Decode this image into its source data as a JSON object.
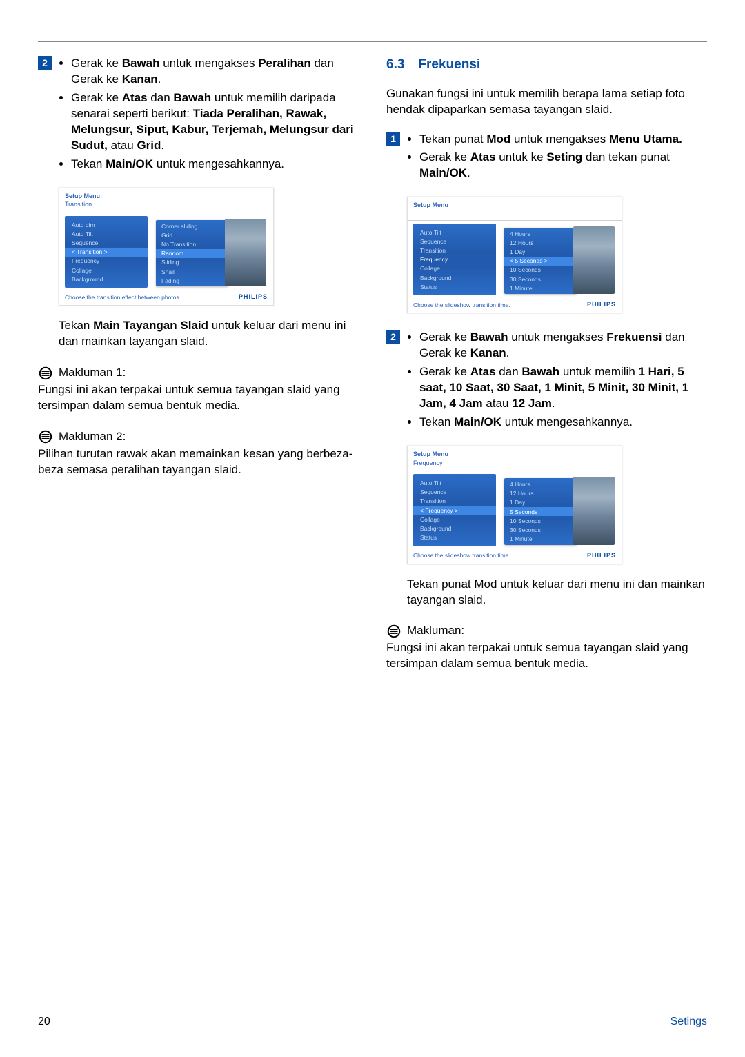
{
  "footer": {
    "page": "20",
    "section": "Setings"
  },
  "left": {
    "step2": {
      "num": "2",
      "b1_prefix": "Gerak ke ",
      "b1_bold1": "Bawah",
      "b1_mid": " untuk mengakses ",
      "b1_bold2": "Peralihan",
      "b1_mid2": " dan Gerak ke ",
      "b1_bold3": "Kanan",
      "b1_suffix": ".",
      "b2_prefix": "Gerak ke ",
      "b2_bold1": "Atas",
      "b2_mid": " dan ",
      "b2_bold2": "Bawah",
      "b2_mid2": " untuk memilih daripada senarai seperti berikut: ",
      "b2_boldlist": "Tiada Peralihan, Rawak, Melungsur, Siput, Kabur, Terjemah, Melungsur dari Sudut,",
      "b2_mid3": " atau ",
      "b2_bold3": "Grid",
      "b2_suffix": ".",
      "b3_prefix": "Tekan ",
      "b3_bold": "Main/OK",
      "b3_suffix": " untuk mengesahkannya."
    },
    "shot1": {
      "title1": "Setup Menu",
      "title2": "Transition",
      "left_items": [
        "Auto dim",
        "Auto Tilt",
        "Sequence",
        "< Transition >",
        "Frequency",
        "Collage",
        "Background"
      ],
      "left_sel_idx": 3,
      "right_items": [
        "Corner sliding",
        "Grid",
        "No Transition",
        "Random",
        "Sliding",
        "Snail",
        "Fading"
      ],
      "right_sel_idx": 3,
      "hint": "Choose the transition effect between photos.",
      "brand": "PHILIPS"
    },
    "after_shot_prefix": "Tekan ",
    "after_shot_bold": "Main Tayangan Slaid",
    "after_shot_suffix": " untuk keluar dari menu ini dan mainkan tayangan slaid.",
    "note1_title": "Makluman 1:",
    "note1_body": "Fungsi ini akan terpakai untuk semua tayangan slaid yang tersimpan dalam semua bentuk media.",
    "note2_title": "Makluman 2:",
    "note2_body": "Pilihan turutan rawak akan memainkan kesan yang berbeza-beza semasa peralihan tayangan slaid."
  },
  "right": {
    "sec_num": "6.3",
    "sec_title": "Frekuensi",
    "intro": "Gunakan fungsi ini untuk memilih berapa lama setiap foto hendak dipaparkan semasa tayangan slaid.",
    "step1": {
      "num": "1",
      "b1_prefix": "Tekan punat ",
      "b1_bold1": "Mod",
      "b1_mid": " untuk mengakses ",
      "b1_bold2": "Menu Utama.",
      "b2_prefix": "Gerak ke ",
      "b2_bold1": "Atas",
      "b2_mid": " untuk ke ",
      "b2_bold2": "Seting",
      "b2_mid2": " dan tekan punat ",
      "b2_bold3": "Main/OK",
      "b2_suffix": "."
    },
    "shot2": {
      "title1": "Setup Menu",
      "title2": "",
      "left_items": [
        "Auto Tilt",
        "Sequence",
        "Transition",
        "Frequency",
        "Collage",
        "Background",
        "Status"
      ],
      "left_hilite_idx": 3,
      "right_items": [
        "4 Hours",
        "12 Hours",
        "1 Day",
        "< 5 Seconds >",
        "10 Seconds",
        "30 Seconds",
        "1 Minute"
      ],
      "right_sel_idx": 3,
      "hint": "Choose the slideshow transition time.",
      "brand": "PHILIPS"
    },
    "step2": {
      "num": "2",
      "b1_prefix": "Gerak ke ",
      "b1_bold1": "Bawah",
      "b1_mid": " untuk mengakses ",
      "b1_bold2": "Frekuensi ",
      "b1_mid2": " dan Gerak ke ",
      "b1_bold3": "Kanan",
      "b1_suffix": ".",
      "b2_prefix": "Gerak ke ",
      "b2_bold1": "Atas",
      "b2_mid": " dan ",
      "b2_bold2": "Bawah",
      "b2_mid2": " untuk memilih ",
      "b2_boldlist": "1 Hari, 5 saat, 10 Saat, 30 Saat, 1 Minit, 5 Minit, 30 Minit, 1 Jam, 4 Jam",
      "b2_mid3": " atau ",
      "b2_bold3": "12 Jam",
      "b2_suffix": ".",
      "b3_prefix": "Tekan ",
      "b3_bold": "Main/OK",
      "b3_suffix": " untuk mengesahkannya."
    },
    "shot3": {
      "title1": "Setup Menu",
      "title2": "Frequency",
      "left_items": [
        "Auto Tilt",
        "Sequence",
        "Transition",
        "< Frequency >",
        "Collage",
        "Background",
        "Status"
      ],
      "left_sel_idx": 3,
      "right_items": [
        "4 Hours",
        "12 Hours",
        "1 Day",
        "5 Seconds",
        "10 Seconds",
        "30 Seconds",
        "1 Minute"
      ],
      "right_sel_idx": 3,
      "hint": "Choose the slideshow transition time.",
      "brand": "PHILIPS"
    },
    "after_shot3": "Tekan punat Mod untuk keluar dari menu ini dan mainkan tayangan slaid.",
    "note_title": "Makluman:",
    "note_body": "Fungsi ini akan terpakai untuk semua tayangan slaid yang tersimpan dalam semua bentuk media."
  }
}
